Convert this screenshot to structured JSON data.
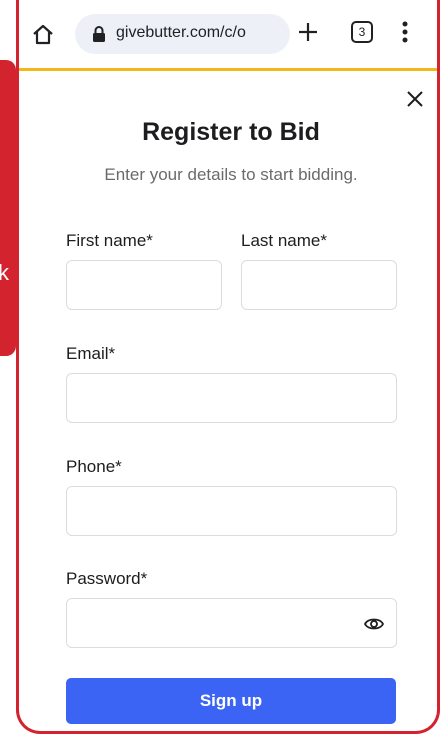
{
  "browser": {
    "url": "givebutter.com/c/o",
    "tab_count": "3"
  },
  "background_page": {
    "edge_char": "k"
  },
  "modal": {
    "title": "Register to Bid",
    "subtitle": "Enter your details to start bidding.",
    "fields": {
      "first_name_label": "First name*",
      "last_name_label": "Last name*",
      "email_label": "Email*",
      "phone_label": "Phone*",
      "password_label": "Password*"
    },
    "submit_label": "Sign up"
  },
  "colors": {
    "accent": "#3b64f5",
    "frame": "#d3232e",
    "loading_bar": "#f3b71b"
  }
}
